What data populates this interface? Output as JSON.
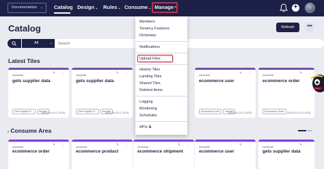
{
  "topnav": {
    "doc_selector": "Documentation",
    "items": [
      {
        "label": "Catalog"
      },
      {
        "label": "Design",
        "caret": "⌄"
      },
      {
        "label": "Rules",
        "caret": "⌄"
      },
      {
        "label": "Consume",
        "caret": "⌄"
      },
      {
        "label": "Manage",
        "caret": "^"
      }
    ]
  },
  "header": {
    "title": "Catalog",
    "refresh_label": "Refresh",
    "more_label": "•••"
  },
  "search": {
    "scope": "All",
    "placeholder": "Search"
  },
  "sections": {
    "latest": "Latest Tiles",
    "consume": "Consume Area"
  },
  "latest_tiles": [
    {
      "type": "consume",
      "title": "gets supplier data",
      "tags": [
        "Gets Supplier D...",
        "low-risk"
      ],
      "date": "2023-03-21 (7,623)"
    },
    {
      "type": "compute",
      "title": "gets supplier data",
      "tags": [
        "Gets Supplier D...",
        "low-risk"
      ],
      "date": "2023-03-22 (7,623)"
    },
    {
      "type": "consume",
      "title": "ecommerce user",
      "tags": [
        "Ecommerce User",
        "low-risk"
      ],
      "date": "2023-03-13 (7,623)"
    },
    {
      "type": "consume",
      "title": "ecommerce order",
      "tags": [
        "Ecommerce Order"
      ],
      "date": "2023-03-13 (7,623)"
    }
  ],
  "consume_tiles": [
    {
      "type": "consume",
      "title": "ecommerce order"
    },
    {
      "type": "consume",
      "title": "ecommerce product"
    },
    {
      "type": "consume",
      "title": "ecommerce shipment"
    },
    {
      "type": "consume",
      "title": "ecommerce user"
    },
    {
      "type": "consume",
      "title": "gets supplier data"
    }
  ],
  "manage_menu": {
    "group1": [
      "Members",
      "Tenancy Features",
      "Dictionary"
    ],
    "group2": [
      "Notifications"
    ],
    "group3": [
      "Upload Files"
    ],
    "group4": [
      "History Tiles",
      "Landing Tiles",
      "Shared Tiles",
      "Deleted Items"
    ],
    "group5": [
      "Logging",
      "Monitoring",
      "Schedules"
    ],
    "group6": [
      "APIs"
    ]
  },
  "colors": {
    "nav_bg": "#1e2147",
    "accent_bar": "#7d3fe0",
    "highlight": "#e2233b"
  },
  "icons": {
    "bell": "bell-icon",
    "add": "plus-circle-icon",
    "search": "search-icon",
    "edit": "pencil-icon",
    "menu": "kebab-icon",
    "external": "external-link-icon"
  }
}
